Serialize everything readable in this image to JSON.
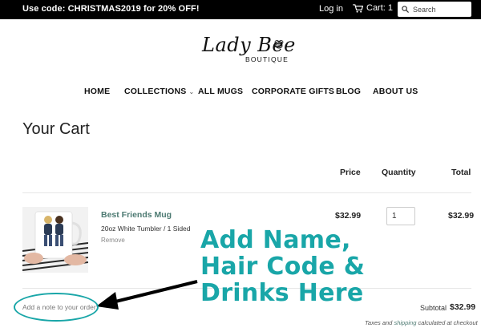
{
  "announcement": {
    "text": "Use code: CHRISTMAS2019 for 20% OFF!"
  },
  "header": {
    "login_label": "Log in",
    "cart_label": "Cart: 1",
    "search_placeholder": "Search"
  },
  "logo": {
    "script_text": "Lady Bee",
    "sub_text": "BOUTIQUE"
  },
  "nav": {
    "items": [
      {
        "label": "HOME"
      },
      {
        "label": "COLLECTIONS",
        "has_dropdown": true
      },
      {
        "label": "ALL MUGS"
      },
      {
        "label": "CORPORATE GIFTS"
      },
      {
        "label": "BLOG"
      },
      {
        "label": "ABOUT US"
      }
    ]
  },
  "cart": {
    "title": "Your Cart",
    "columns": {
      "price": "Price",
      "quantity": "Quantity",
      "total": "Total"
    },
    "items": [
      {
        "name": "Best Friends Mug",
        "variant": "20oz White Tumbler / 1 Sided",
        "remove_label": "Remove",
        "price": "$32.99",
        "quantity": "1",
        "total": "$32.99"
      }
    ],
    "note_placeholder": "Add a note to your order",
    "subtotal_label": "Subtotal",
    "subtotal_value": "$32.99",
    "taxes_prefix": "Taxes and",
    "taxes_link": "shipping",
    "taxes_suffix": "calculated at checkout"
  },
  "callout": {
    "lines": [
      "Add Name,",
      "Hair Code &",
      "Drinks Here"
    ],
    "color": "#19a6a8"
  },
  "colors": {
    "accent": "#19a6a8",
    "link": "#4d7a72",
    "topbar": "#000000"
  }
}
